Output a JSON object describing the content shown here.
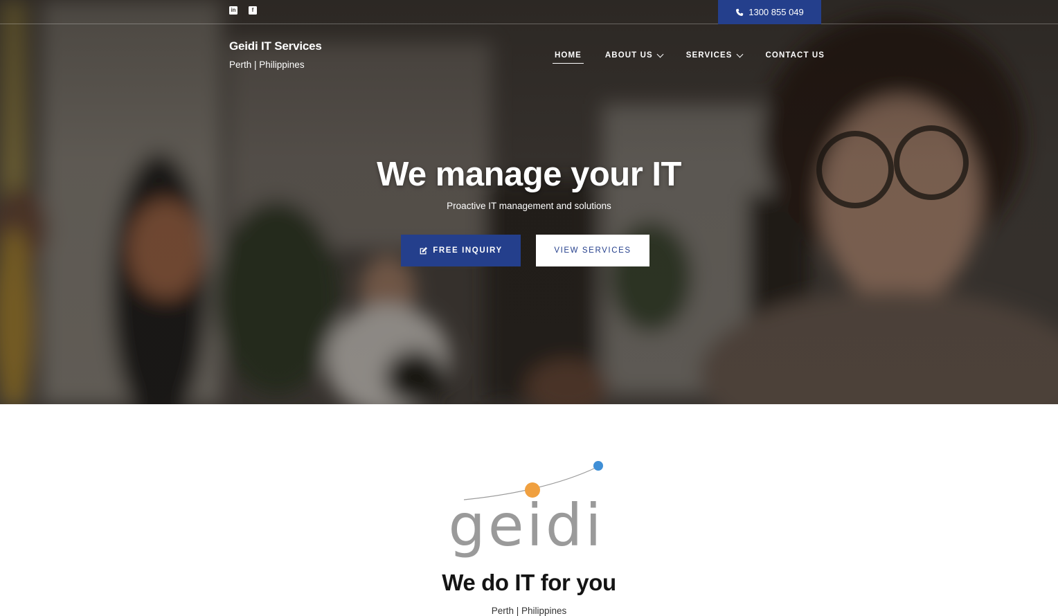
{
  "topbar": {
    "social": [
      {
        "icon": "linkedin-icon",
        "glyph": "in"
      },
      {
        "icon": "facebook-icon",
        "glyph": "f"
      }
    ],
    "phone": "1300 855 049"
  },
  "brand": {
    "title": "Geidi IT Services",
    "subtitle": "Perth | Philippines"
  },
  "nav": {
    "items": [
      {
        "label": "HOME",
        "active": true
      },
      {
        "label": "ABOUT US",
        "dropdown": true
      },
      {
        "label": "SERVICES",
        "dropdown": true
      },
      {
        "label": "CONTACT US"
      }
    ]
  },
  "hero": {
    "title": "We manage your IT",
    "subtitle": "Proactive IT management and solutions",
    "primary_button": "FREE INQUIRY",
    "secondary_button": "VIEW SERVICES"
  },
  "intro": {
    "logo_text": "geidi",
    "title": "We do IT for you",
    "subtitle": "Perth | Philippines"
  },
  "colors": {
    "accent": "#243f8c",
    "logo_orange": "#f0a040",
    "logo_blue": "#3f8fd6",
    "logo_gray": "#9a9a9a"
  }
}
